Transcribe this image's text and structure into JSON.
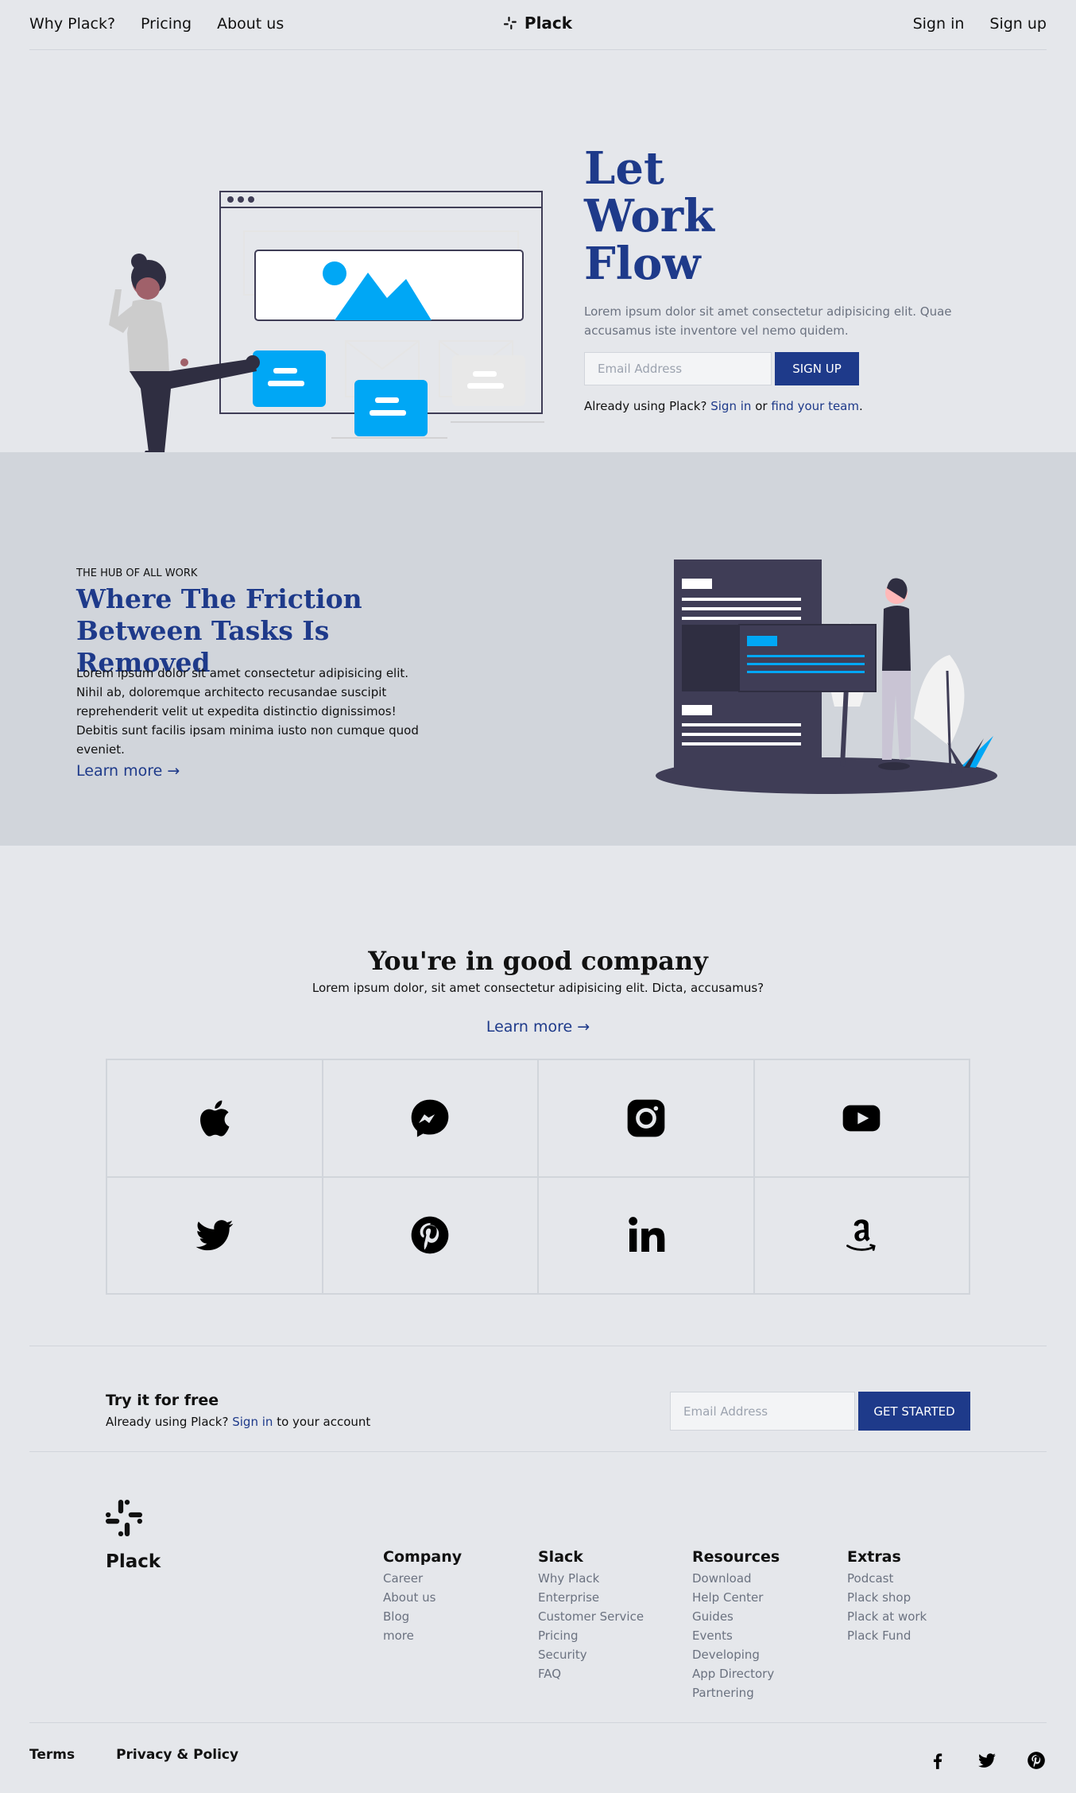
{
  "nav": {
    "links": [
      "Why Plack?",
      "Pricing",
      "About us"
    ],
    "brand": "Plack",
    "sign_in": "Sign in",
    "sign_up": "Sign up"
  },
  "hero": {
    "title_lines": [
      "Let",
      "Work",
      "Flow"
    ],
    "subtitle": "Lorem ipsum dolor sit amet consectetur adipisicing elit. Quae accusamus iste inventore vel nemo quidem.",
    "email_placeholder": "Email Address",
    "signup_label": "SIGN UP",
    "already_prefix": "Already using Plack?",
    "sign_in_link": "Sign in",
    "or_text": "or",
    "find_team_link": "find your team",
    "period": "."
  },
  "feature": {
    "kicker": "THE HUB OF ALL WORK",
    "title": "Where The Friction Between Tasks Is Removed",
    "body": "Lorem ipsum dolor sit amet consectetur adipisicing elit. Nihil ab, doloremque architecto recusandae suscipit reprehenderit velit ut expedita distinctio dignissimos! Debitis sunt facilis ipsam minima iusto non cumque quod eveniet.",
    "learn_more": "Learn more →"
  },
  "company": {
    "title": "You're in good company",
    "subtitle": "Lorem ipsum dolor, sit amet consectetur adipisicing elit. Dicta, accusamus?",
    "learn_more": "Learn more →",
    "logos": [
      "apple-icon",
      "messenger-icon",
      "instagram-icon",
      "youtube-icon",
      "twitter-icon",
      "pinterest-icon",
      "linkedin-icon",
      "amazon-icon"
    ]
  },
  "cta": {
    "title": "Try it for free",
    "sub_prefix": "Already using Plack?",
    "sign_in_link": "Sign in",
    "sub_suffix": "to your account",
    "email_placeholder": "Email Address",
    "button": "GET STARTED"
  },
  "footer": {
    "brand": "Plack",
    "columns": [
      {
        "title": "Company",
        "items": [
          "Career",
          "About us",
          "Blog",
          "more"
        ]
      },
      {
        "title": "Slack",
        "items": [
          "Why Plack",
          "Enterprise",
          "Customer Service",
          "Pricing",
          "Security",
          "FAQ"
        ]
      },
      {
        "title": "Resources",
        "items": [
          "Download",
          "Help Center",
          "Guides",
          "Events",
          "Developing",
          "App Directory",
          "Partnering"
        ]
      },
      {
        "title": "Extras",
        "items": [
          "Podcast",
          "Plack shop",
          "Plack at work",
          "Plack Fund"
        ]
      }
    ],
    "terms": "Terms",
    "privacy": "Privacy & Policy",
    "socials": [
      "facebook-icon",
      "twitter-icon",
      "pinterest-icon"
    ]
  },
  "colors": {
    "accent": "#1e3a8a",
    "illustration_blue": "#00a7f5",
    "background": "#e5e7eb",
    "band": "#d1d5db"
  }
}
